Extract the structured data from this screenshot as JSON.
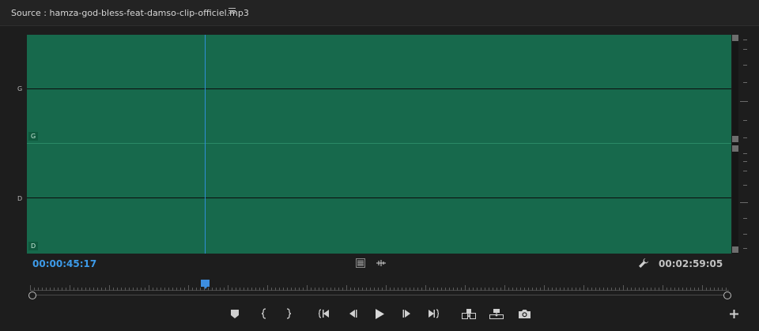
{
  "panel": {
    "title": "Source : hamza-god-bless-feat-damso-clip-officiel.mp3",
    "menu_icon": "hamburger-menu-icon"
  },
  "waveform": {
    "channels": [
      {
        "side_label": "G",
        "tag": "G"
      },
      {
        "side_label": "D",
        "tag": "D"
      }
    ],
    "color": "#17694c",
    "playhead_color": "#2f8ed8"
  },
  "timecode": {
    "current": "00:00:45:17",
    "duration": "00:02:59:05",
    "current_color": "#3d9be9"
  },
  "playhead_position": 0.2523,
  "toolbar_icons": [
    "export-frame-icon",
    "waveform-toggle-icon",
    "wrench-settings-icon"
  ],
  "transport_icons": [
    "add-marker-icon",
    "mark-in-icon",
    "mark-out-icon",
    "go-to-in-icon",
    "step-back-icon",
    "play-icon",
    "step-forward-icon",
    "go-to-out-icon",
    "insert-icon",
    "overwrite-icon",
    "camera-icon",
    "add-button-icon"
  ]
}
